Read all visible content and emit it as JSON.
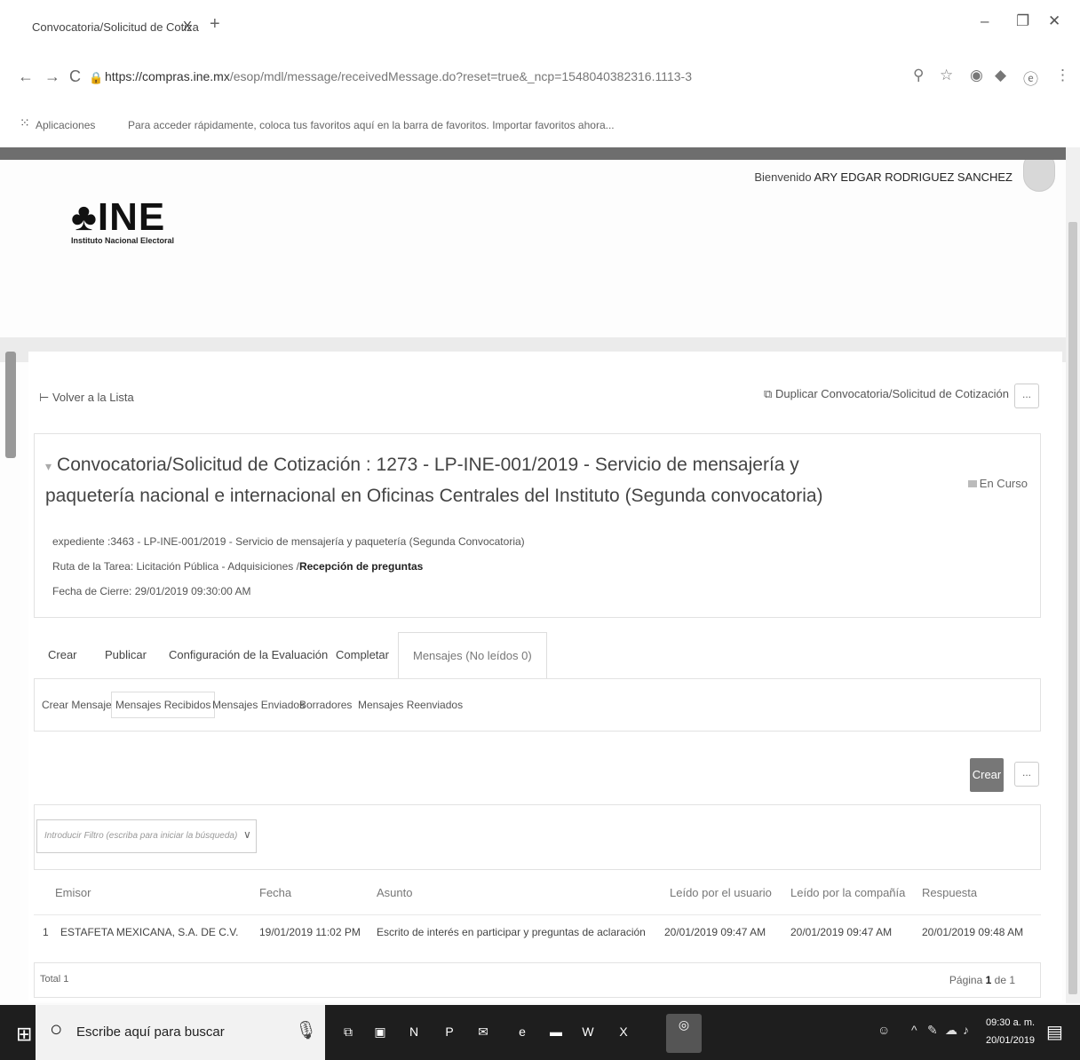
{
  "browser": {
    "tab_title": "Convocatoria/Solicitud de Cotiza",
    "tab_close": "X",
    "new_tab": "+",
    "url_host": "https://compras.ine.mx",
    "url_path": "/esop/mdl/message/receivedMessage.do?reset=true&_ncp=1548040382316.1113-3",
    "bookmarks_apps": "Aplicaciones",
    "bookmarks_hint": "Para acceder rápidamente, coloca tus favoritos aquí en la barra de favoritos. Importar favoritos ahora..."
  },
  "header": {
    "welcome_prefix": "Bienvenido",
    "user_name": "ARY EDGAR RODRIGUEZ SANCHEZ",
    "logo_text": "INE",
    "logo_subtitle": "Instituto Nacional Electoral"
  },
  "toolbar": {
    "back_label": "Volver a la Lista",
    "duplicate_label": "Duplicar Convocatoria/Solicitud de Cotización",
    "more_label": "..."
  },
  "detail": {
    "title": "Convocatoria/Solicitud de Cotización : 1273 - LP-INE-001/2019 - Servicio de mensajería y paquetería nacional e internacional en Oficinas Centrales del Instituto (Segunda convocatoria)",
    "status": "En Curso",
    "expediente": "expediente :3463 - LP-INE-001/2019 - Servicio de mensajería y paquetería (Segunda Convocatoria)",
    "ruta_prefix": "Ruta de la Tarea: Licitación Pública - Adquisiciones /",
    "ruta_current": "Recepción de preguntas",
    "fecha_cierre": "Fecha de Cierre: 29/01/2019 09:30:00 AM"
  },
  "tabs": [
    "Crear",
    "Publicar",
    "Configuración de la Evaluación",
    "Completar",
    "Mensajes (No leídos 0)"
  ],
  "subtabs": [
    "Crear Mensaje",
    "Mensajes Recibidos",
    "Mensajes Enviados",
    "Borradores",
    "Mensajes Reenviados"
  ],
  "actions": {
    "create_label": "Crear",
    "more_label": "..."
  },
  "filter": {
    "placeholder": "Introducir Filtro (escriba para iniciar la búsqueda)"
  },
  "table": {
    "columns": [
      "Emisor",
      "Fecha",
      "Asunto",
      "Leído por el usuario",
      "Leído por la compañía",
      "Respuesta"
    ],
    "rows": [
      {
        "index": "1",
        "emisor": "ESTAFETA MEXICANA, S.A. DE C.V.",
        "fecha": "19/01/2019 11:02 PM",
        "asunto": "Escrito de interés en participar y preguntas de aclaración",
        "leido_usuario": "20/01/2019 09:47 AM",
        "leido_compania": "20/01/2019 09:47 AM",
        "respuesta": "20/01/2019 09:48 AM"
      }
    ],
    "total": "Total 1",
    "page_prefix": "Página",
    "page_current": "1",
    "page_suffix": "de 1"
  },
  "taskbar": {
    "search_placeholder": "Escribe aquí para buscar",
    "time": "09:30 a. m.",
    "date": "20/01/2019"
  }
}
